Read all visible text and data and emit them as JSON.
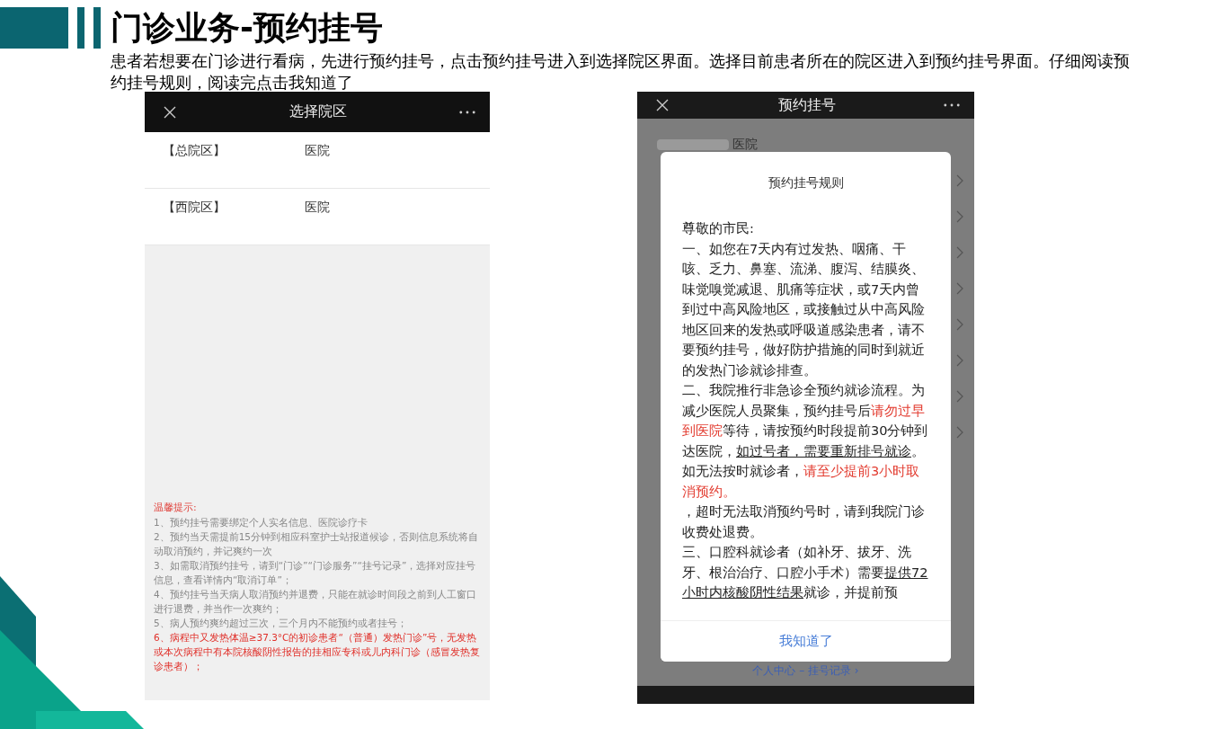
{
  "title": "门诊业务-预约挂号",
  "description": "患者若想要在门诊进行看病，先进行预约挂号，点击预约挂号进入到选择院区界面。选择目前患者所在的院区进入到预约挂号界面。仔细阅读预约挂号规则，阅读完点击我知道了",
  "phone_left": {
    "header_title": "选择院区",
    "campuses": [
      {
        "name": "【总院区】",
        "hospital": "医院"
      },
      {
        "name": "【西院区】",
        "hospital": "医院"
      }
    ],
    "tips_title": "温馨提示:",
    "tips": [
      {
        "text": "1、预约挂号需要绑定个人实名信息、医院诊疗卡",
        "kind": "normal"
      },
      {
        "text": "2、预约当天需提前15分钟到相应科室护士站报道候诊，否则信息系统将自动取消预约，并记爽约一次",
        "kind": "normal"
      },
      {
        "text": "3、如需取消预约挂号，请到“门诊”“门诊服务”“挂号记录”，选择对应挂号信息，查看详情内“取消订单”；",
        "kind": "normal"
      },
      {
        "text": "4、预约挂号当天病人取消预约并退费，只能在就诊时间段之前到人工窗口进行退费，并当作一次爽约；",
        "kind": "normal"
      },
      {
        "text": "5、病人预约爽约超过三次，三个月内不能预约或者挂号；",
        "kind": "normal"
      },
      {
        "text": "6、病程中又发热体温≥37.3°C的初诊患者“（普通）发热门诊”号，无发热或本次病程中有本院核酸阴性报告的挂相应专科或儿内科门诊（感冒发热复诊患者）；",
        "kind": "warning"
      }
    ]
  },
  "phone_right": {
    "header_title": "预约挂号",
    "hospital_label": "医院",
    "footer_link": "个人中心 – 挂号记录 ›",
    "modal": {
      "title": "预约挂号规则",
      "paragraphs": [
        [
          {
            "text": "尊敬的市民:",
            "kind": "normal"
          }
        ],
        [
          {
            "text": "一、如您在7天内有过发热、咽痛、干咳、乏力、鼻塞、流涕、腹泻、结膜炎、味觉嗅觉减退、肌痛等症状，或7天内曾到过中高风险地区，或接触过从中高风险地区回来的发热或呼吸道感染患者，请不要预约挂号，做好防护措施的同时到就近的发热门诊就诊排查。",
            "kind": "normal"
          }
        ],
        [
          {
            "text": "二、我院推行非急诊全预约就诊流程。为减少医院人员聚集，预约挂号后",
            "kind": "normal"
          },
          {
            "text": "请勿过早到医院",
            "kind": "red"
          },
          {
            "text": "等待，请按预约时段提前30分钟到达医院，",
            "kind": "normal"
          },
          {
            "text": "如过号者，需要重新排号就诊",
            "kind": "underline"
          },
          {
            "text": "。如无法按时就诊者，",
            "kind": "normal"
          },
          {
            "text": "请至少提前3小时取消预约。",
            "kind": "red"
          }
        ],
        [
          {
            "text": "，超时无法取消预约号时，请到我院门诊收费处退费。",
            "kind": "normal"
          }
        ],
        [
          {
            "text": "三、口腔科就诊者（如补牙、拔牙、洗牙、根治治疗、口腔小手术）需要",
            "kind": "normal"
          },
          {
            "text": "提供72小时内核酸阴性结果",
            "kind": "underline"
          },
          {
            "text": "就诊，并提前预",
            "kind": "normal"
          }
        ]
      ],
      "button": "我知道了"
    }
  }
}
